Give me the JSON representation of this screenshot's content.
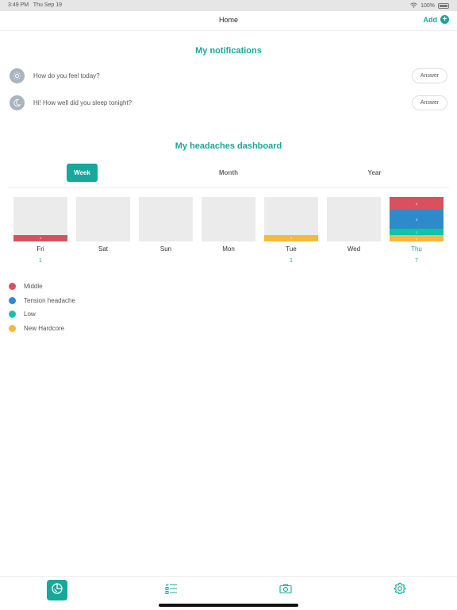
{
  "status_bar": {
    "time": "3:49 PM",
    "date": "Thu Sep 19",
    "battery": "100%"
  },
  "nav": {
    "title": "Home",
    "add_label": "Add"
  },
  "notifications": {
    "title": "My notifications",
    "items": [
      {
        "icon": "sun-icon",
        "text": "How do you feel today?",
        "button": "Answer"
      },
      {
        "icon": "moon-icon",
        "text": "Hi! How well did you sleep tonight?",
        "button": "Answer"
      }
    ]
  },
  "dashboard": {
    "title": "My headaches dashboard",
    "tabs": [
      "Week",
      "Month",
      "Year"
    ],
    "active_tab": "Week"
  },
  "chart_data": {
    "type": "bar",
    "stacked": true,
    "categories": [
      "Fri",
      "Sat",
      "Sun",
      "Mon",
      "Tue",
      "Wed",
      "Thu"
    ],
    "totals": [
      1,
      0,
      0,
      0,
      1,
      0,
      7
    ],
    "highlighted_category": "Thu",
    "series": [
      {
        "name": "New Hardcore",
        "color": "#f6b93b",
        "values": [
          0,
          0,
          0,
          0,
          1,
          0,
          1
        ]
      },
      {
        "name": "Low",
        "color": "#13c2a8",
        "values": [
          0,
          0,
          0,
          0,
          0,
          0,
          1
        ]
      },
      {
        "name": "Tension headache",
        "color": "#2e8bc9",
        "values": [
          0,
          0,
          0,
          0,
          0,
          0,
          3
        ]
      },
      {
        "name": "Middle",
        "color": "#d9505e",
        "values": [
          1,
          0,
          0,
          0,
          0,
          0,
          2
        ]
      }
    ],
    "ylim": [
      0,
      7
    ]
  },
  "legend": [
    {
      "label": "Middle",
      "color": "#d9505e"
    },
    {
      "label": "Tension headache",
      "color": "#2e8bc9"
    },
    {
      "label": "Low",
      "color": "#13c2a8"
    },
    {
      "label": "New Hardcore",
      "color": "#f6b93b"
    }
  ],
  "tab_bar": {
    "items": [
      {
        "icon": "dashboard-icon",
        "active": true
      },
      {
        "icon": "checklist-icon",
        "active": false
      },
      {
        "icon": "camera-icon",
        "active": false
      },
      {
        "icon": "gear-icon",
        "active": false
      }
    ]
  }
}
